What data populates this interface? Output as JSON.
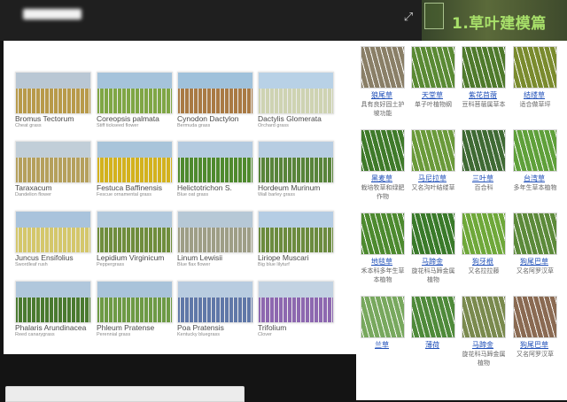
{
  "header": {
    "title": "1.草叶建模篇"
  },
  "plants_gallery": [
    {
      "name": "Bromus Tectorum",
      "common": "Cheat grass",
      "sky": "#b9c7d4",
      "ground": "#b89a4a"
    },
    {
      "name": "Coreopsis palmata",
      "common": "Stiff tickseed flower",
      "sky": "#a5c3db",
      "ground": "#7fa645"
    },
    {
      "name": "Cynodon Dactylon",
      "common": "Bermuda grass",
      "sky": "#9fc1db",
      "ground": "#a97a44"
    },
    {
      "name": "Dactylis Glomerata",
      "common": "Orchard grass",
      "sky": "#b8d1e6",
      "ground": "#ced3b2"
    },
    {
      "name": "Taraxacum",
      "common": "Dandelion flower",
      "sky": "#c1ced8",
      "ground": "#b5a05c"
    },
    {
      "name": "Festuca Baffinensis",
      "common": "Fescue ornamental grass",
      "sky": "#a8c4da",
      "ground": "#d3b21d"
    },
    {
      "name": "Helictotrichon S.",
      "common": "Blue oat grass",
      "sky": "#b4cbe0",
      "ground": "#4f8a2e"
    },
    {
      "name": "Hordeum Murinum",
      "common": "Wall barley grass",
      "sky": "#b7cde2",
      "ground": "#58843a"
    },
    {
      "name": "Juncus Ensifolius",
      "common": "Swordleaf rush",
      "sky": "#a9c3dc",
      "ground": "#d4c76b"
    },
    {
      "name": "Lepidium Virginicum",
      "common": "Peppergrass",
      "sky": "#b2c9dd",
      "ground": "#6f8d3c"
    },
    {
      "name": "Linum Lewisii",
      "common": "Blue flax flower",
      "sky": "#b6c8d6",
      "ground": "#9e9e86"
    },
    {
      "name": "Liriope Muscari",
      "common": "Big blue lilyturf",
      "sky": "#b5cde4",
      "ground": "#6b8b3e"
    },
    {
      "name": "Phalaris Arundinacea",
      "common": "Reed canarygrass",
      "sky": "#b0c7dc",
      "ground": "#4a7a30"
    },
    {
      "name": "Phleum Pratense",
      "common": "Perennial grass",
      "sky": "#a9c3da",
      "ground": "#6d9a45"
    },
    {
      "name": "Poa Pratensis",
      "common": "Kentucky bluegrass",
      "sky": "#b8cce0",
      "ground": "#6078a8"
    },
    {
      "name": "Trifolium",
      "common": "Clover",
      "sky": "#c2d2e2",
      "ground": "#8d68b0"
    }
  ],
  "grass_reference": [
    {
      "label": "狼尾草",
      "desc": "具有良好固土护坡功能",
      "color": "#8a7f67"
    },
    {
      "label": "天堂草",
      "desc": "单子叶植物纲",
      "color": "#5a8a34"
    },
    {
      "label": "紫花苜蓿",
      "desc": "豆科苜蓿属草本",
      "color": "#4f7a2c"
    },
    {
      "label": "结缕草",
      "desc": "适合做草坪",
      "color": "#7a8b2e"
    },
    {
      "label": "黑麦草",
      "desc": "栽培牧草和绿肥作物",
      "color": "#3f7a2a"
    },
    {
      "label": "马尼拉草",
      "desc": "又名沟叶结缕草",
      "color": "#6a9a3a"
    },
    {
      "label": "三叶草",
      "desc": "百合科",
      "color": "#3f6a34"
    },
    {
      "label": "台湾草",
      "desc": "多年生草本植物",
      "color": "#5fa03a"
    },
    {
      "label": "地毯草",
      "desc": "禾本科多年生草本植物",
      "color": "#4d8a2f"
    },
    {
      "label": "马蹄金",
      "desc": "旋花科马蹄金属植物",
      "color": "#3a7a2a"
    },
    {
      "label": "狗牙根",
      "desc": "又名拉拉藤",
      "color": "#6fa83a"
    },
    {
      "label": "狗尾巴草",
      "desc": "又名阿罗汉草",
      "color": "#5c8a3a"
    },
    {
      "label": "兰草",
      "desc": "",
      "color": "#78a85e"
    },
    {
      "label": "薄荷",
      "desc": "",
      "color": "#4f8a3a"
    },
    {
      "label": "马蹄金",
      "desc": "旋花科马蹄金属植物",
      "color": "#7a8a4e"
    },
    {
      "label": "狗尾巴草",
      "desc": "又名阿罗汉草",
      "color": "#8a6a52"
    }
  ]
}
